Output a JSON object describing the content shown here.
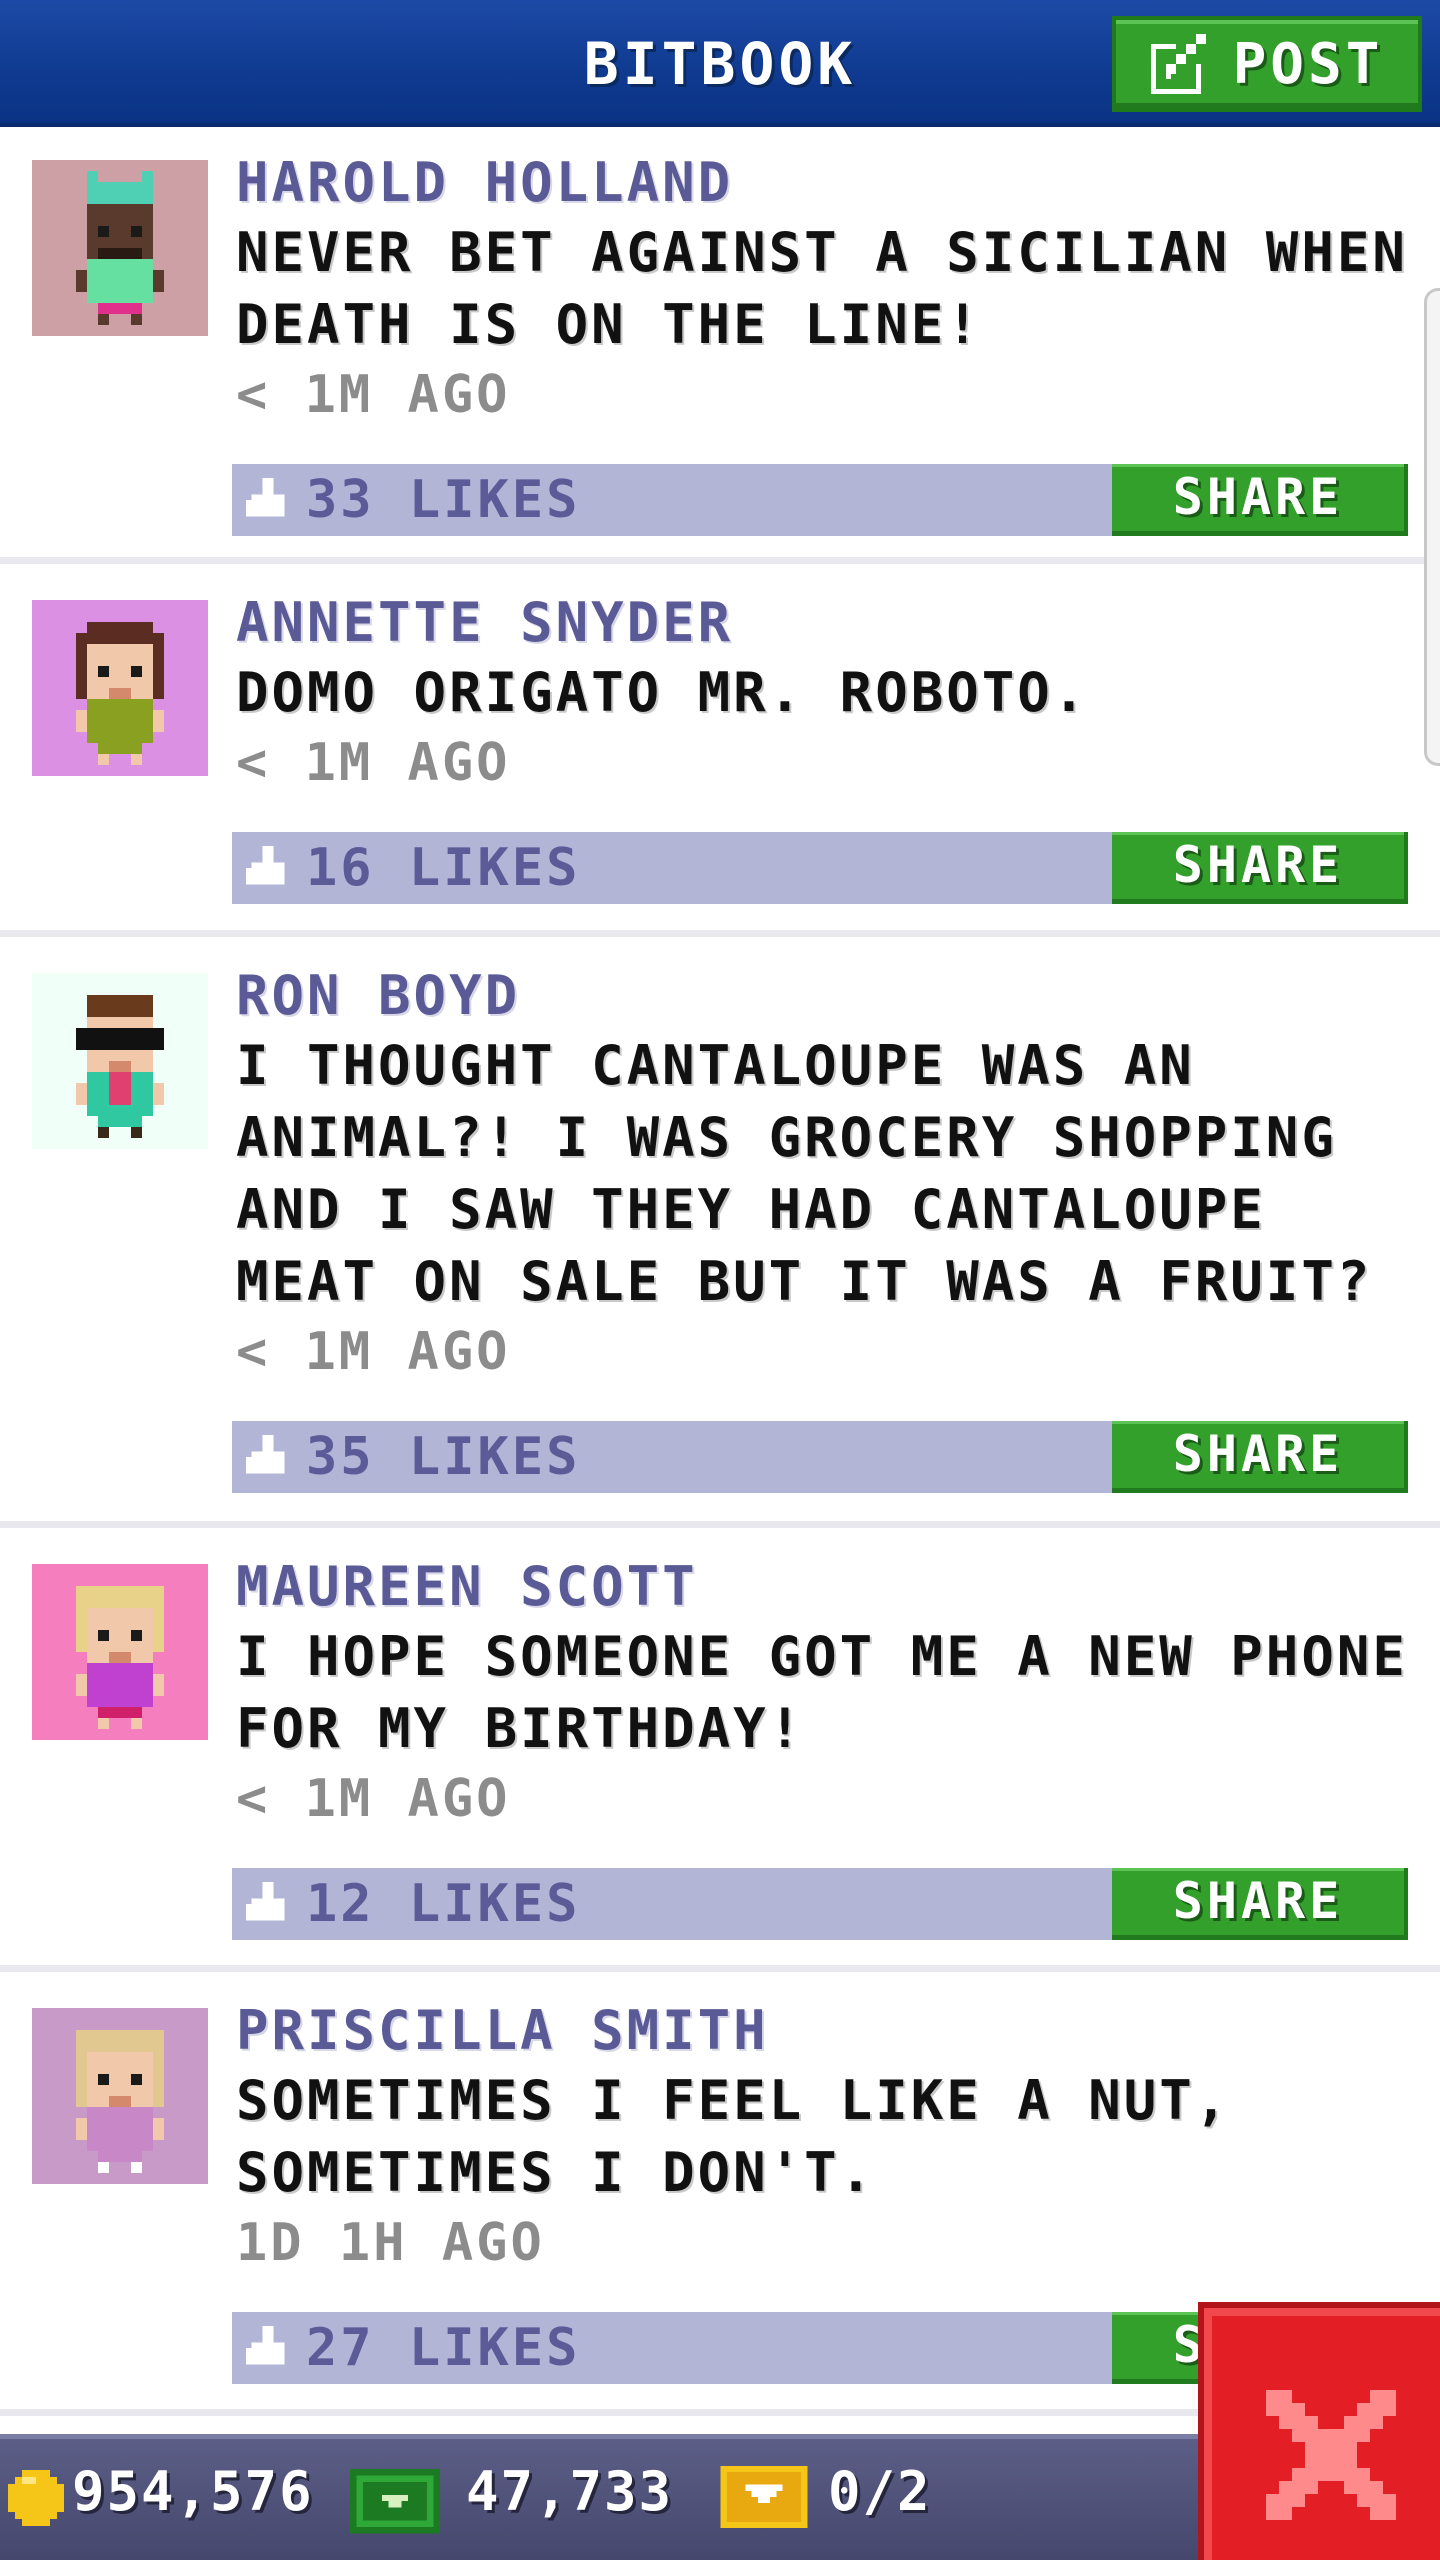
{
  "header": {
    "title": "BITBOOK",
    "post_label": "POST"
  },
  "posts": [
    {
      "author": "HAROLD HOLLAND",
      "message": "NEVER BET AGAINST A SICILIAN WHEN DEATH IS ON THE LINE!",
      "time": "< 1M AGO",
      "likes": "33 LIKES",
      "share": "SHARE",
      "avatar_bg": "#cca0a4"
    },
    {
      "author": "ANNETTE SNYDER",
      "message": "DOMO ORIGATO MR. ROBOTO.",
      "time": "< 1M AGO",
      "likes": "16 LIKES",
      "share": "SHARE",
      "avatar_bg": "#dc90e3"
    },
    {
      "author": "RON BOYD",
      "message": "I THOUGHT CANTALOUPE WAS AN ANIMAL?! I WAS GROCERY SHOPPING AND I SAW THEY HAD CANTALOUPE MEAT ON SALE BUT IT WAS A FRUIT?",
      "time": "< 1M AGO",
      "likes": "35 LIKES",
      "share": "SHARE",
      "avatar_bg": "#f0fff8"
    },
    {
      "author": "MAUREEN SCOTT",
      "message": "I HOPE SOMEONE GOT ME A NEW PHONE FOR MY BIRTHDAY!",
      "time": "< 1M AGO",
      "likes": "12 LIKES",
      "share": "SHARE",
      "avatar_bg": "#f57fbe"
    },
    {
      "author": "PRISCILLA SMITH",
      "message": "SOMETIMES I FEEL LIKE A NUT, SOMETIMES I DON'T.",
      "time": "1D 1H AGO",
      "likes": "27 LIKES",
      "share": "SHARE",
      "avatar_bg": "#c89ac8"
    }
  ],
  "footer": {
    "coins": "954,576",
    "cash": "47,733",
    "tickets": "0/2"
  },
  "colors": {
    "header": "#0f3a90",
    "accent_green": "#33a02c",
    "like_bar": "#b3b5d6",
    "author": "#5a5a96",
    "close_red": "#e31e24"
  }
}
